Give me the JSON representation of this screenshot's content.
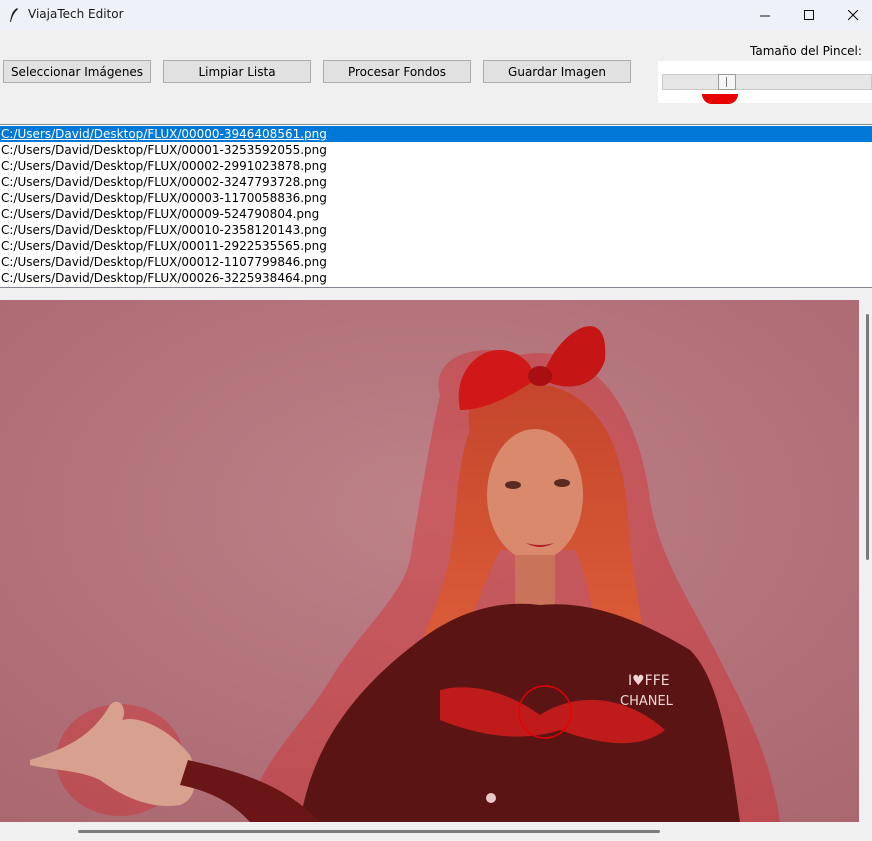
{
  "window": {
    "title": "ViajaTech Editor",
    "minimize_icon": "minimize-icon",
    "maximize_icon": "maximize-icon",
    "close_icon": "close-icon"
  },
  "toolbar": {
    "select_images": "Seleccionar Imágenes",
    "clear_list": "Limpiar Lista",
    "process_backgrounds": "Procesar Fondos",
    "save_image": "Guardar Imagen",
    "brush_size_label": "Tamaño del Pincel:",
    "brush_size_value": 0.29,
    "brush_color": "#e60000"
  },
  "file_list": {
    "selected_index": 0,
    "items": [
      "C:/Users/David/Desktop/FLUX/00000-3946408561.png",
      "C:/Users/David/Desktop/FLUX/00001-3253592055.png",
      "C:/Users/David/Desktop/FLUX/00002-2991023878.png",
      "C:/Users/David/Desktop/FLUX/00002-3247793728.png",
      "C:/Users/David/Desktop/FLUX/00003-1170058836.png",
      "C:/Users/David/Desktop/FLUX/00009-524790804.png",
      "C:/Users/David/Desktop/FLUX/00010-2358120143.png",
      "C:/Users/David/Desktop/FLUX/00011-2922535565.png",
      "C:/Users/David/Desktop/FLUX/00012-1107799846.png",
      "C:/Users/David/Desktop/FLUX/00026-3225938464.png"
    ]
  },
  "canvas": {
    "mask_color": "#e60000",
    "background_color": "#b2737b",
    "jacket_text_line1": "I♥FFE",
    "jacket_text_line2": "CHANEL"
  }
}
